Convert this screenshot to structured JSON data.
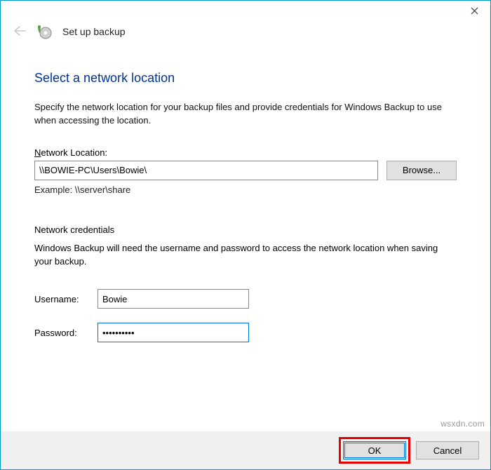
{
  "header": {
    "wizard_title": "Set up backup"
  },
  "main": {
    "heading": "Select a network location",
    "description": "Specify the network location for your backup files and provide credentials for Windows Backup to use when accessing the location.",
    "location_label_pre": "N",
    "location_label_rest": "etwork Location:",
    "location_value": "\\\\BOWIE-PC\\Users\\Bowie\\",
    "browse_label": "Browse...",
    "example_text": "Example: \\\\server\\share",
    "creds_heading": "Network credentials",
    "creds_description": "Windows Backup will need the username and password to access the network location when saving your backup.",
    "username_label_pre": "U",
    "username_label_rest": "sername:",
    "username_value": "Bowie",
    "password_label_pre": "P",
    "password_label_rest": "assword:",
    "password_value": "••••••••••"
  },
  "footer": {
    "ok_label": "OK",
    "cancel_label": "Cancel"
  },
  "watermark": "wsxdn.com"
}
